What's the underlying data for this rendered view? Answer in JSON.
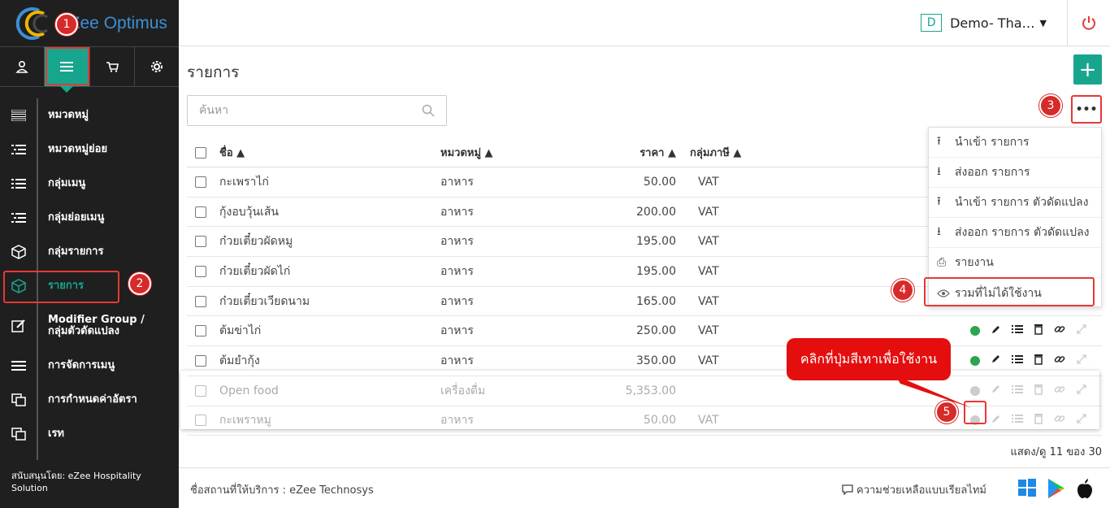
{
  "app": {
    "name": "eZee Optimus"
  },
  "header": {
    "org_badge": "D",
    "org_name": "Demo- Tha…"
  },
  "sidebar": {
    "items": [
      {
        "label": "หมวดหมู่"
      },
      {
        "label": "หมวดหมู่ย่อย"
      },
      {
        "label": "กลุ่มเมนู"
      },
      {
        "label": "กลุ่มย่อยเมนู"
      },
      {
        "label": "กลุ่มรายการ"
      },
      {
        "label": "รายการ"
      },
      {
        "label": "Modifier Group / กลุ่มตัวดัดแปลง"
      },
      {
        "label": "การจัดการเมนู"
      },
      {
        "label": "การกำหนดค่าอัตรา"
      },
      {
        "label": "เรท"
      }
    ],
    "sponsor": "สนับสนุนโดย: eZee Hospitality Solution"
  },
  "main": {
    "title": "รายการ",
    "add_label": "+",
    "search_placeholder": "ค้นหา",
    "more_label": "•••",
    "columns": {
      "name": "ชื่อ",
      "category": "หมวดหมู่",
      "price": "ราคา",
      "tax": "กลุ่มภาษี"
    },
    "rows": [
      {
        "name": "กะเพราไก่",
        "category": "อาหาร",
        "price": "50.00",
        "tax": "VAT",
        "active": true
      },
      {
        "name": "กุ้งอบวุ้นเส้น",
        "category": "อาหาร",
        "price": "200.00",
        "tax": "VAT",
        "active": true
      },
      {
        "name": "ก๋วยเตี๋ยวผัดหมู",
        "category": "อาหาร",
        "price": "195.00",
        "tax": "VAT",
        "active": true
      },
      {
        "name": "ก๋วยเตี๋ยวผัดไก่",
        "category": "อาหาร",
        "price": "195.00",
        "tax": "VAT",
        "active": true
      },
      {
        "name": "ก๋วยเตี๋ยวเวียดนาม",
        "category": "อาหาร",
        "price": "165.00",
        "tax": "VAT",
        "active": true
      },
      {
        "name": "ต้มข่าไก่",
        "category": "อาหาร",
        "price": "250.00",
        "tax": "VAT",
        "active": true
      },
      {
        "name": "ต้มยำกุ้ง",
        "category": "อาหาร",
        "price": "350.00",
        "tax": "VAT",
        "active": true
      },
      {
        "name": "Open food",
        "category": "เครื่องดื่ม",
        "price": "5,353.00",
        "tax": "",
        "active": false
      },
      {
        "name": "กะเพราหมู",
        "category": "อาหาร",
        "price": "50.00",
        "tax": "VAT",
        "active": false
      }
    ],
    "count": "แสดง/ดู 11 ของ 30"
  },
  "dropdown": {
    "items": [
      {
        "label": "นำเข้า รายการ",
        "icon": "upload-icon"
      },
      {
        "label": "ส่งออก รายการ",
        "icon": "download-icon"
      },
      {
        "label": "นำเข้า รายการ ตัวดัดแปลง",
        "icon": "upload-icon"
      },
      {
        "label": "ส่งออก รายการ ตัวดัดแปลง",
        "icon": "download-icon"
      },
      {
        "label": "รายงาน",
        "icon": "print-icon"
      },
      {
        "label": "รวมที่ไม่ได้ใช้งาน",
        "icon": "eye-icon"
      }
    ]
  },
  "footer": {
    "powered_by": "ชื่อสถานที่ให้บริการ : eZee Technosys",
    "support": "ความช่วยเหลือแบบเรียลไทม์"
  },
  "annotations": {
    "steps": [
      "1",
      "2",
      "3",
      "4",
      "5"
    ],
    "callout": "คลิกที่ปุ่มสีเทาเพื่อใช้งาน"
  },
  "colors": {
    "accent": "#18a58e",
    "sidebar": "#1f1f1f",
    "annotation": "#d72a2a",
    "active_dot": "#2ea44f"
  }
}
